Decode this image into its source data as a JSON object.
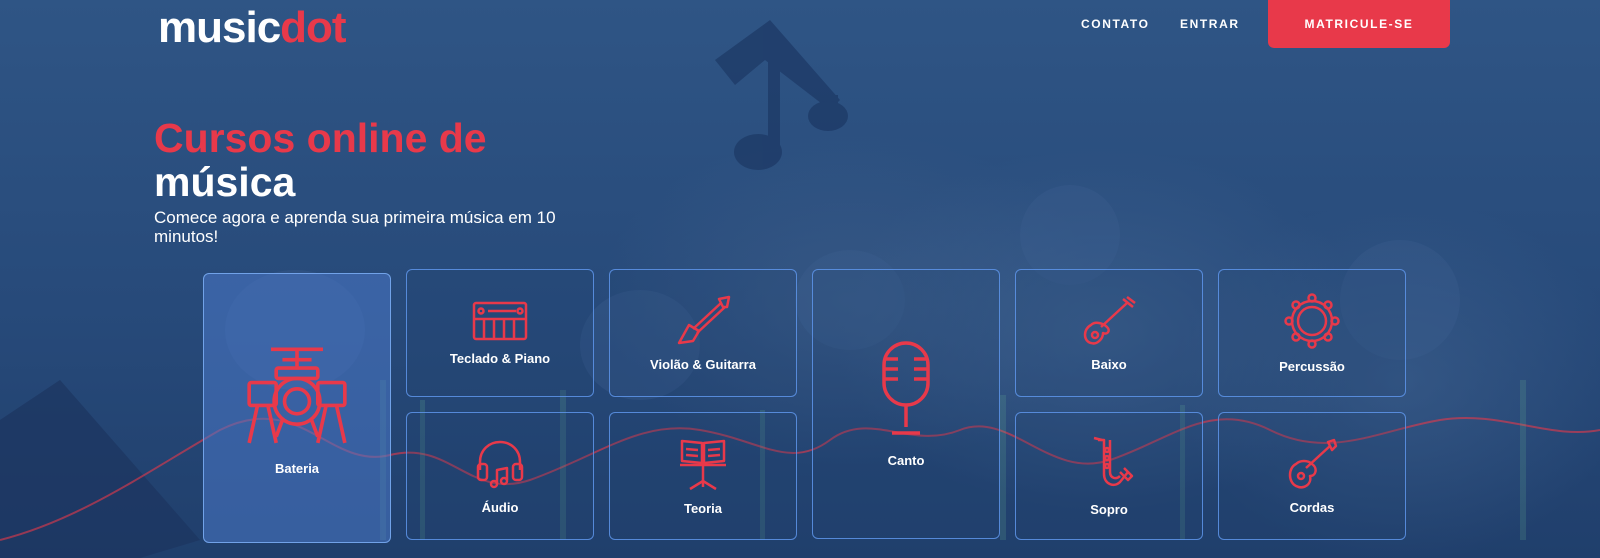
{
  "brand": {
    "name_part1": "music",
    "name_part2": "dot",
    "accent": "#e8394a"
  },
  "nav": {
    "links": [
      {
        "label": "CONTATO"
      },
      {
        "label": "ENTRAR"
      }
    ],
    "cta": "MATRICULE-SE"
  },
  "hero": {
    "title_line1": "Cursos online de",
    "title_line2": "música",
    "subtitle": "Comece agora e aprenda sua primeira música em 10 minutos!"
  },
  "courses": [
    {
      "label": "Bateria",
      "icon": "drum-kit-icon"
    },
    {
      "label": "Teclado & Piano",
      "icon": "keyboard-icon"
    },
    {
      "label": "Violão & Guitarra",
      "icon": "electric-guitar-icon"
    },
    {
      "label": "Canto",
      "icon": "microphone-icon"
    },
    {
      "label": "Baixo",
      "icon": "bass-guitar-icon"
    },
    {
      "label": "Percussão",
      "icon": "tambourine-icon"
    },
    {
      "label": "Áudio",
      "icon": "headphones-icon"
    },
    {
      "label": "Teoria",
      "icon": "music-stand-icon"
    },
    {
      "label": "Sopro",
      "icon": "saxophone-icon"
    },
    {
      "label": "Cordas",
      "icon": "violin-icon"
    }
  ],
  "colors": {
    "background": "#2a4c7c",
    "card_border": "#5f96eb",
    "accent": "#e8394a"
  }
}
